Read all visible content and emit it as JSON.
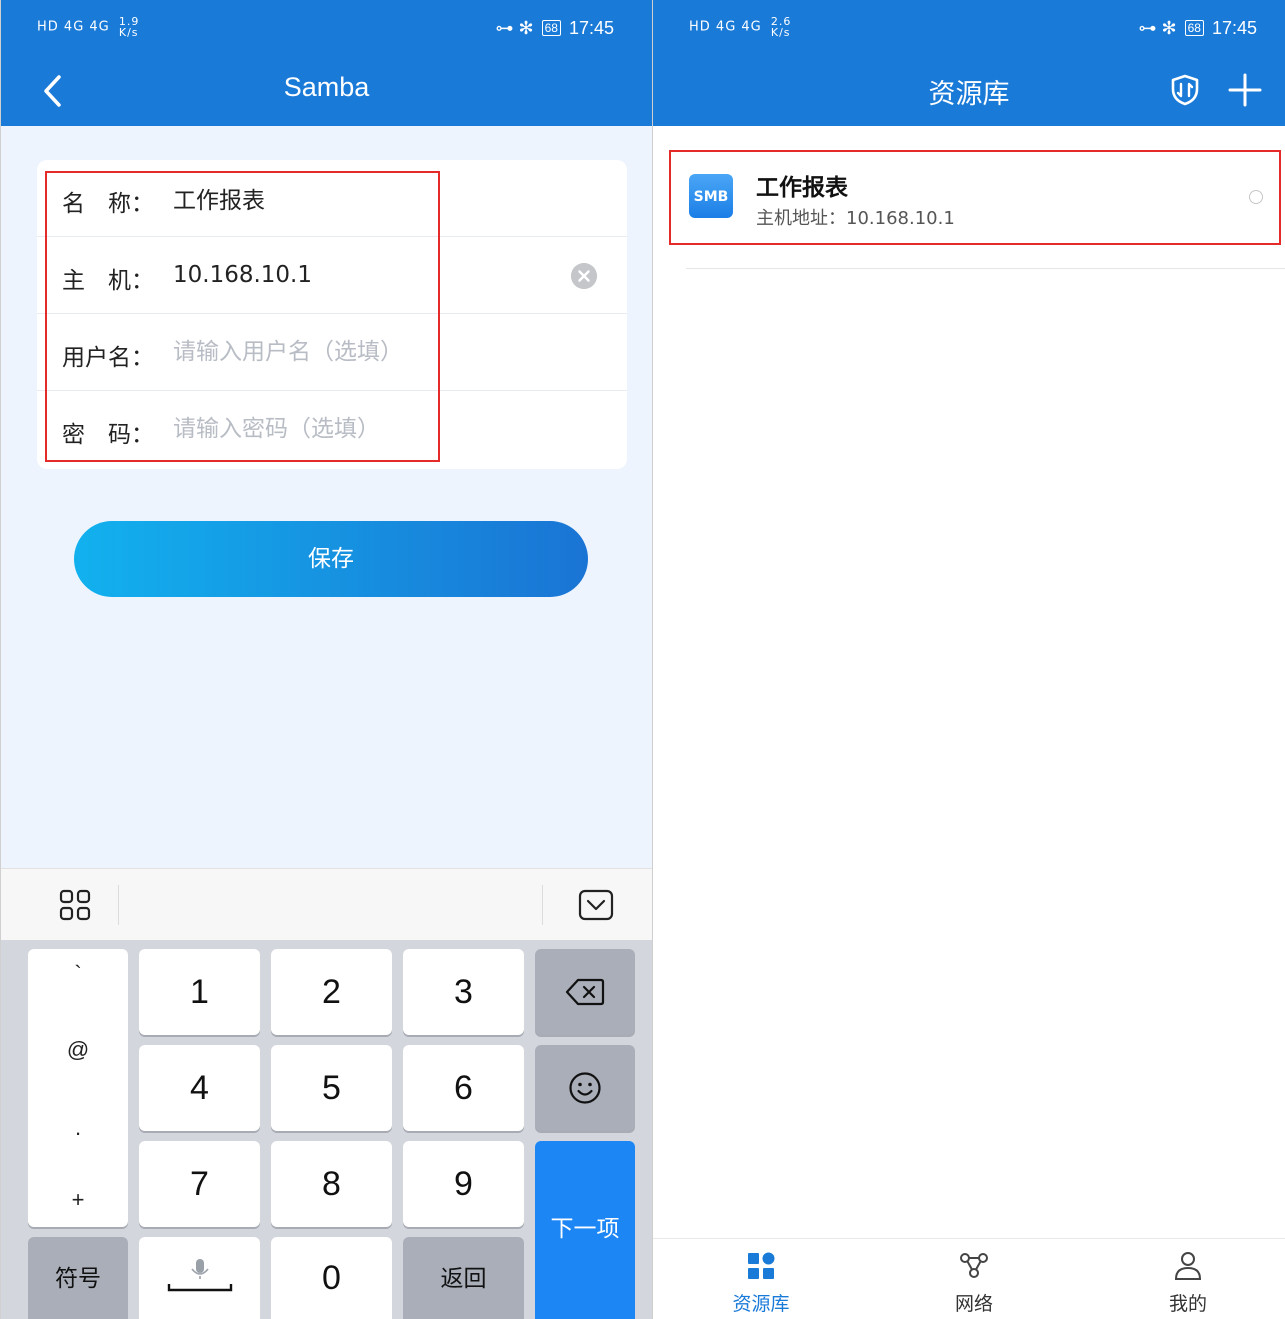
{
  "left_screen": {
    "status_bar": {
      "signal": "HD 4G 4G",
      "speed_value": "1.9",
      "speed_unit": "K/s",
      "battery": "68",
      "time": "17:45"
    },
    "title": "Samba",
    "form": {
      "name_label": "名　称：",
      "name_value": "工作报表",
      "host_label": "主　机：",
      "host_value": "10.168.10.1",
      "username_label": "用户名：",
      "username_placeholder": "请输入用户名（选填）",
      "password_label": "密　码：",
      "password_placeholder": "请输入密码（选填）"
    },
    "save_label": "保存",
    "keyboard": {
      "symbols": [
        "`",
        "@",
        ".",
        "+"
      ],
      "digits": [
        "1",
        "2",
        "3",
        "4",
        "5",
        "6",
        "7",
        "8",
        "9",
        "0"
      ],
      "symbol_key": "符号",
      "return_key": "返回",
      "next_key": "下一项"
    }
  },
  "right_screen": {
    "status_bar": {
      "signal": "HD 4G 4G",
      "speed_value": "2.6",
      "speed_unit": "K/s",
      "battery": "68",
      "time": "17:45"
    },
    "title": "资源库",
    "resource": {
      "icon_text": "SMB",
      "name": "工作报表",
      "host": "主机地址：10.168.10.1"
    },
    "nav": {
      "library": "资源库",
      "network": "网络",
      "mine": "我的"
    },
    "accent_color": "#1a7ad8"
  },
  "highlight_color": "#e52a2a"
}
